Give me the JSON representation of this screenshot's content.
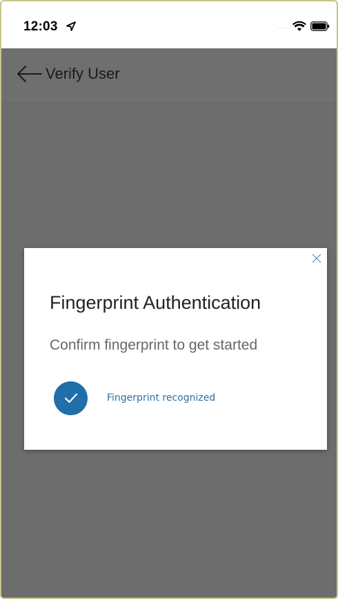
{
  "status_bar": {
    "time": "12:03",
    "location_icon": "location-arrow-icon",
    "signal": "....",
    "wifi_icon": "wifi-icon",
    "battery_icon": "battery-icon"
  },
  "header": {
    "back_icon": "arrow-left-icon",
    "title": "Verify User"
  },
  "dialog": {
    "close_icon": "close-icon",
    "title": "Fingerprint Authentication",
    "subtitle": "Confirm fingerprint to get started",
    "status_icon": "checkmark-circle-icon",
    "status_text": "Fingerprint recognized"
  },
  "colors": {
    "overlay": "#6d6d6d",
    "accent": "#1f6fa8",
    "status_text": "#2b6ea3"
  }
}
